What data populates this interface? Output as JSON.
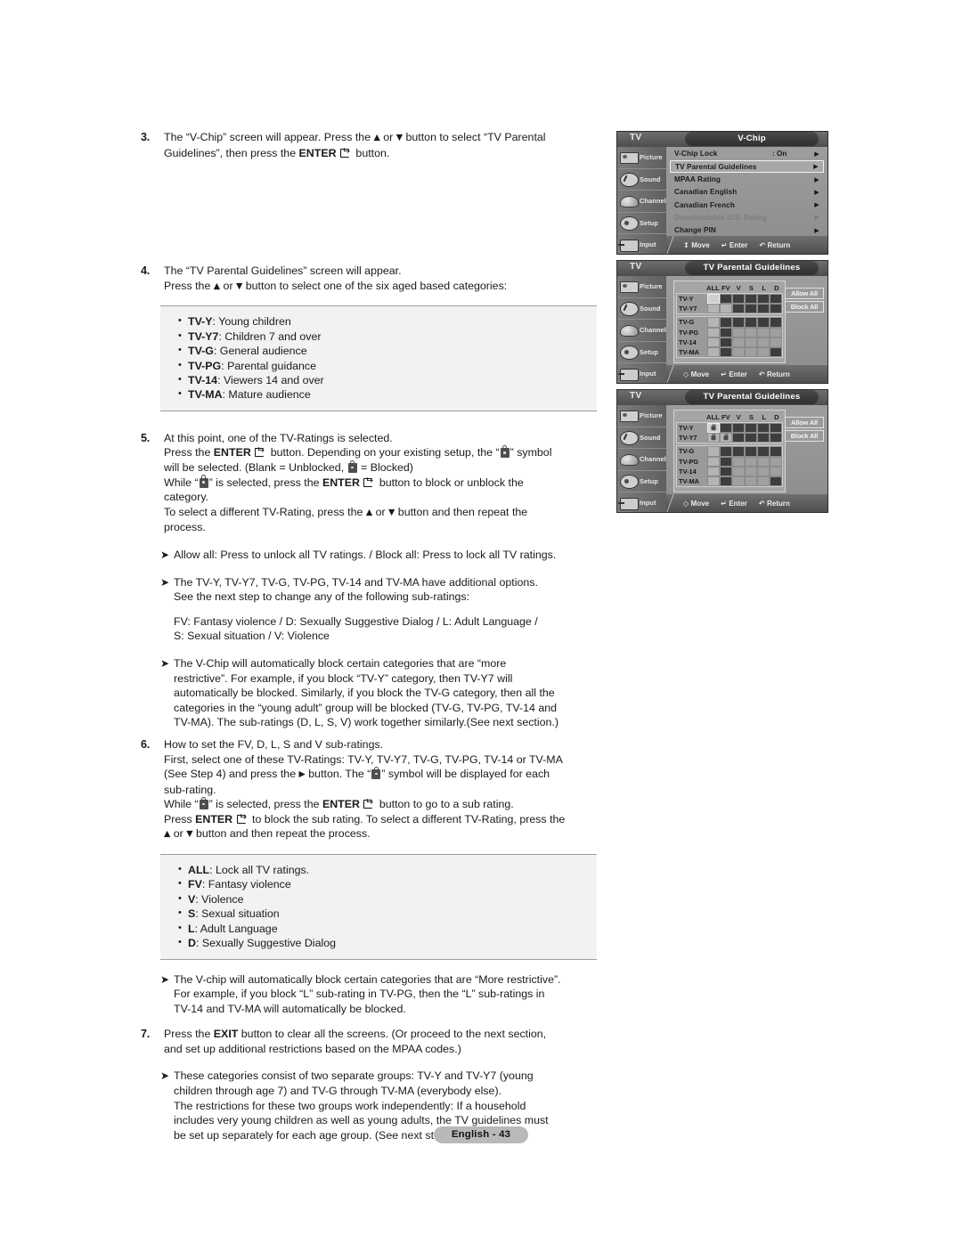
{
  "document": {
    "page_footer": "English - 43"
  },
  "steps": [
    {
      "num": "3.",
      "lines": [
        "The “V-Chip” screen will appear. Press the ▲ or ▼ button to select “TV Parental",
        "Guidelines”, then press the ENTER  button."
      ],
      "l1a": "The “V-Chip” screen will appear. Press the ",
      "l1b": " or ",
      "l1c": " button to select “TV Parental",
      "l2a": "Guidelines”, then press the ",
      "l2b": "ENTER",
      "l2c": " button."
    },
    {
      "num": "4.",
      "l1": "The “TV Parental Guidelines” screen will appear.",
      "l2a": "Press the ",
      "l2b": " or ",
      "l2c": " button to select one of the six aged based categories:"
    },
    {
      "num": "5.",
      "l1": "At this point, one of the TV-Ratings is selected.",
      "l2a": "Press the ",
      "l2b": "ENTER",
      "l2c": " button. Depending on your existing setup, the “",
      "l2d": "” symbol",
      "l3a": "will be selected. (Blank = Unblocked, ",
      "l3b": " = Blocked)",
      "l4a": "While “",
      "l4b": "” is selected, press the ",
      "l4c": "ENTER",
      "l4d": " button to block or unblock the",
      "l5": "category.",
      "l6a": "To select a different TV-Rating, press the ",
      "l6b": " or ",
      "l6c": " button and then repeat the",
      "l7": "process."
    },
    {
      "num": "6.",
      "l1": "How to set the FV, D, L, S and V sub-ratings.",
      "l2": "First, select one of these TV-Ratings: TV-Y, TV-Y7, TV-G, TV-PG, TV-14 or TV-MA",
      "l3a": "(See Step 4) and press the ",
      "l3b": " button. The “",
      "l3c": "” symbol will be displayed for each",
      "l4": "sub-rating.",
      "l5a": "While “",
      "l5b": "” is selected, press the ",
      "l5c": "ENTER",
      "l5d": " button to go to a sub rating.",
      "l6a": "Press ",
      "l6b": "ENTER",
      "l6c": " to block the sub rating. To select a different TV-Rating, press the",
      "l7a": "",
      "l7b": " or ",
      "l7c": " button and then repeat the process."
    },
    {
      "num": "7.",
      "l1a": "Press the ",
      "l1b": "EXIT",
      "l1c": " button to clear all the screens. (Or proceed to the next section,",
      "l2": "and set up additional restrictions based on the MPAA codes.)"
    }
  ],
  "category_list": [
    {
      "term": "TV-Y",
      "desc": ": Young children"
    },
    {
      "term": "TV-Y7",
      "desc": ": Children 7 and over"
    },
    {
      "term": "TV-G",
      "desc": ": General audience"
    },
    {
      "term": "TV-PG",
      "desc": ": Parental guidance"
    },
    {
      "term": "TV-14",
      "desc": ": Viewers 14 and over"
    },
    {
      "term": "TV-MA",
      "desc": ": Mature audience"
    }
  ],
  "subrating_list": [
    {
      "term": "ALL",
      "desc": ": Lock all TV ratings."
    },
    {
      "term": "FV",
      "desc": ": Fantasy violence"
    },
    {
      "term": "V",
      "desc": ": Violence"
    },
    {
      "term": "S",
      "desc": ": Sexual situation"
    },
    {
      "term": "L",
      "desc": ": Adult Language"
    },
    {
      "term": "D",
      "desc": ": Sexually Suggestive Dialog"
    }
  ],
  "notes": {
    "allow_block": "Allow all: Press to unlock all TV ratings. / Block all: Press to lock all TV ratings.",
    "additional_options_l1": "The TV-Y, TV-Y7, TV-G, TV-PG, TV-14 and TV-MA have additional options.",
    "additional_options_l2": "See the next step to change any of the following sub-ratings:",
    "subrating_legend_l1": "FV: Fantasy violence / D: Sexually Suggestive Dialog / L: Adult Language /",
    "subrating_legend_l2": "S: Sexual situation / V: Violence",
    "vchip_auto_l1": "The V-Chip will automatically block certain categories that are “more",
    "vchip_auto_l2": "restrictive”. For example, if you block “TV-Y” category, then TV-Y7 will",
    "vchip_auto_l3": "automatically be blocked. Similarly, if you block the TV-G category, then all the",
    "vchip_auto_l4": "categories in the “young adult” group will be blocked (TV-G, TV-PG, TV-14 and",
    "vchip_auto_l5": "TV-MA). The sub-ratings (D, L, S, V) work together similarly.(See next section.)",
    "vchip_more_l1": "The V-chip will automatically block certain categories that are “More restrictive”.",
    "vchip_more_l2": "For example, if you block “L” sub-rating in TV-PG, then the “L” sub-ratings in",
    "vchip_more_l3": "TV-14 and TV-MA will automatically be blocked.",
    "groups_l1": "These categories consist of two separate groups: TV-Y and TV-Y7 (young",
    "groups_l2": "children through age 7) and TV-G through TV-MA (everybody else).",
    "groups_l3": "The restrictions for these two groups work independently: If a household",
    "groups_l4": "includes very young children as well as young adults, the TV guidelines must",
    "groups_l5": "be set up separately for each age group. (See next step.)"
  },
  "osd": {
    "tv_label": "TV",
    "sidebar": [
      {
        "label": "Picture",
        "icon": "picture-icon"
      },
      {
        "label": "Sound",
        "icon": "sound-icon"
      },
      {
        "label": "Channel",
        "icon": "channel-icon"
      },
      {
        "label": "Setup",
        "icon": "setup-icon"
      },
      {
        "label": "Input",
        "icon": "input-icon"
      }
    ],
    "footer": {
      "move": "Move",
      "enter": "Enter",
      "return": "Return"
    },
    "screen1": {
      "title": "V-Chip",
      "items": [
        {
          "label": "V-Chip Lock",
          "value": ": On",
          "state": "normal"
        },
        {
          "label": "TV Parental Guidelines",
          "value": "",
          "state": "selected"
        },
        {
          "label": "MPAA Rating",
          "value": "",
          "state": "normal"
        },
        {
          "label": "Canadian English",
          "value": "",
          "state": "normal"
        },
        {
          "label": "Canadian French",
          "value": "",
          "state": "normal"
        },
        {
          "label": "Downloadable U.S. Rating",
          "value": "",
          "state": "dim"
        },
        {
          "label": "Change PIN",
          "value": "",
          "state": "normal"
        }
      ]
    },
    "screen2": {
      "title": "TV Parental Guidelines",
      "columns": [
        "ALL",
        "FV",
        "V",
        "S",
        "L",
        "D"
      ],
      "buttons": {
        "allow": "Allow All",
        "block": "Block All"
      },
      "group_a": [
        {
          "label": "TV-Y",
          "cells": [
            "sel",
            "dark",
            "dark",
            "dark",
            "dark",
            "dark"
          ]
        },
        {
          "label": "TV-Y7",
          "cells": [
            "light",
            "light",
            "dark",
            "dark",
            "dark",
            "dark"
          ]
        }
      ],
      "group_b": [
        {
          "label": "TV-G",
          "cells": [
            "light",
            "dark",
            "dark",
            "dark",
            "dark",
            "dark"
          ]
        },
        {
          "label": "TV-PG",
          "cells": [
            "light",
            "dark",
            "mid",
            "mid",
            "mid",
            "mid"
          ]
        },
        {
          "label": "TV-14",
          "cells": [
            "light",
            "dark",
            "mid",
            "mid",
            "mid",
            "mid"
          ]
        },
        {
          "label": "TV-MA",
          "cells": [
            "light",
            "dark",
            "mid",
            "mid",
            "mid",
            "dark"
          ]
        }
      ]
    },
    "screen3": {
      "title": "TV Parental Guidelines",
      "columns": [
        "ALL",
        "FV",
        "V",
        "S",
        "L",
        "D"
      ],
      "buttons": {
        "allow": "Allow All",
        "block": "Block All"
      },
      "group_a": [
        {
          "label": "TV-Y",
          "cells": [
            "sel-lock",
            "dark",
            "dark",
            "dark",
            "dark",
            "dark"
          ]
        },
        {
          "label": "TV-Y7",
          "cells": [
            "lock",
            "lock",
            "dark",
            "dark",
            "dark",
            "dark"
          ]
        }
      ],
      "group_b": [
        {
          "label": "TV-G",
          "cells": [
            "light",
            "dark",
            "dark",
            "dark",
            "dark",
            "dark"
          ]
        },
        {
          "label": "TV-PG",
          "cells": [
            "light",
            "dark",
            "mid",
            "mid",
            "mid",
            "mid"
          ]
        },
        {
          "label": "TV-14",
          "cells": [
            "light",
            "dark",
            "mid",
            "mid",
            "mid",
            "mid"
          ]
        },
        {
          "label": "TV-MA",
          "cells": [
            "light",
            "dark",
            "mid",
            "mid",
            "mid",
            "dark"
          ]
        }
      ]
    }
  }
}
